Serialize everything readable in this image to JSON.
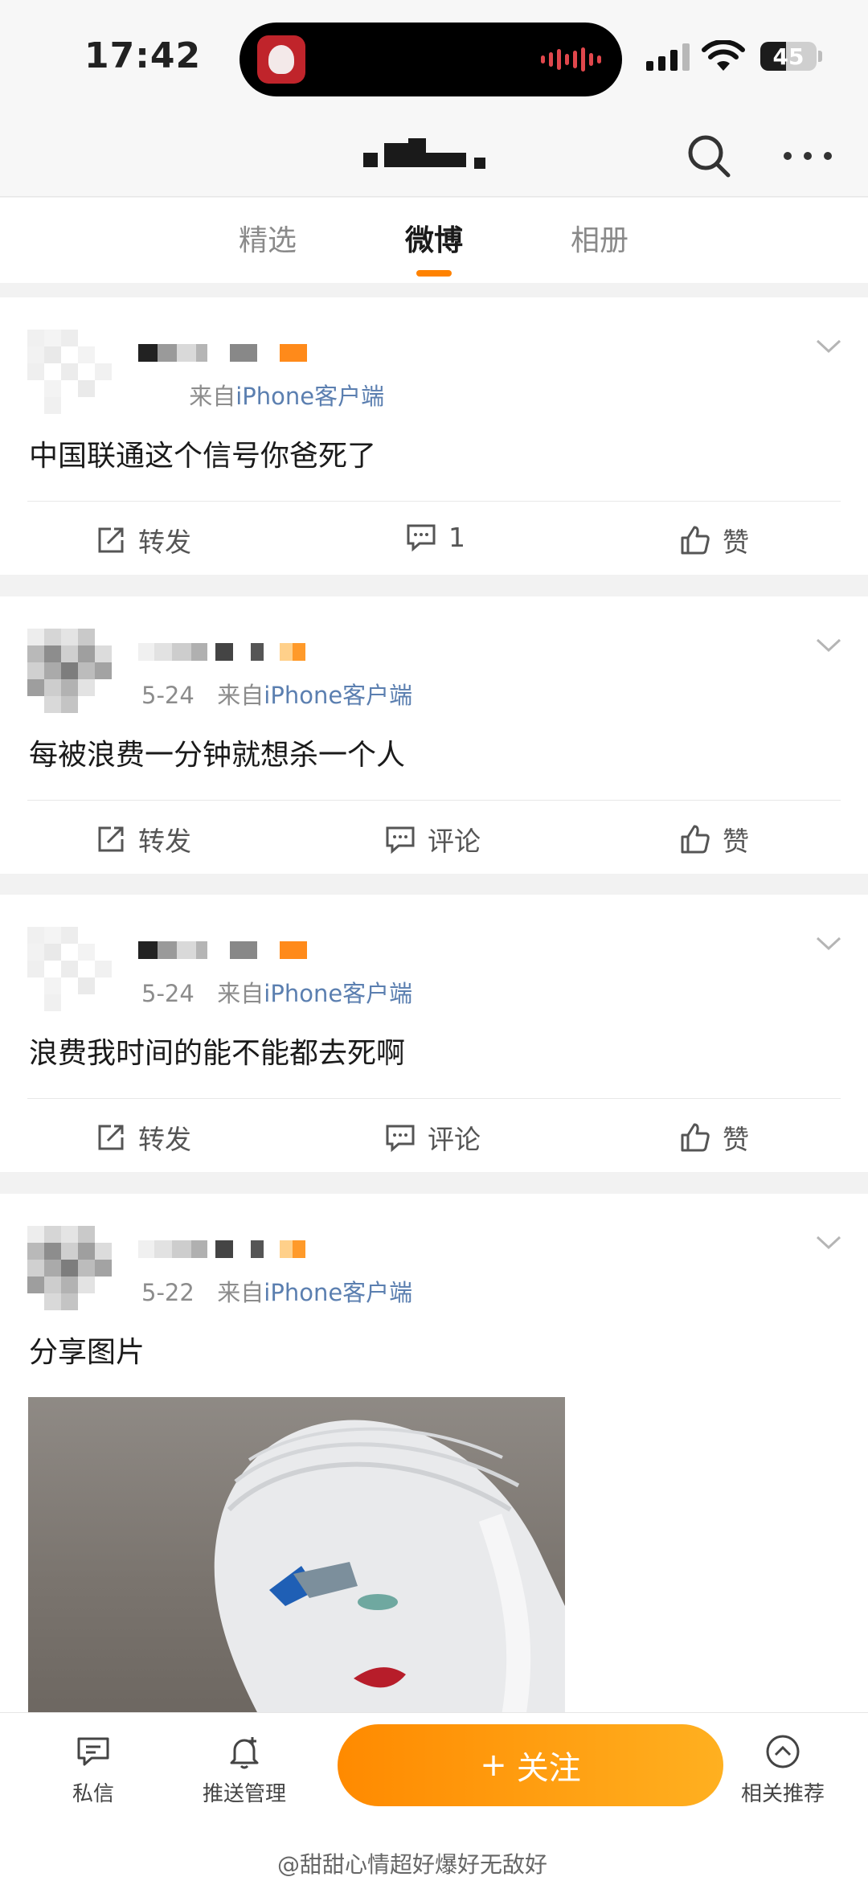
{
  "status_bar": {
    "time": "17:42",
    "battery": "45",
    "battery_level": 0.45
  },
  "nav": {
    "search_icon": "search-icon",
    "more_icon": "more-icon"
  },
  "tabs": [
    {
      "label": "精选",
      "active": false
    },
    {
      "label": "微博",
      "active": true
    },
    {
      "label": "相册",
      "active": false
    }
  ],
  "posts": [
    {
      "date": "",
      "source": "iPhone客户端",
      "meta_prefix": "来自",
      "text": "中国联通这个信号你爸死了",
      "repost": "转发",
      "comment": "1",
      "like": "赞"
    },
    {
      "date": "5-24",
      "source": "iPhone客户端",
      "meta_prefix": "来自",
      "text": "每被浪费一分钟就想杀一个人",
      "repost": "转发",
      "comment": "评论",
      "like": "赞"
    },
    {
      "date": "5-24",
      "source": "iPhone客户端",
      "meta_prefix": "来自",
      "text": "浪费我时间的能不能都去死啊",
      "repost": "转发",
      "comment": "评论",
      "like": "赞"
    },
    {
      "date": "5-22",
      "source": "iPhone客户端",
      "meta_prefix": "来自",
      "text": "分享图片",
      "repost": "",
      "comment": "",
      "like": ""
    }
  ],
  "bottom_bar": {
    "messages": "私信",
    "push": "推送管理",
    "follow": "关注",
    "follow_plus": "+",
    "related": "相关推荐"
  },
  "watermark": "@甜甜心情超好爆好无敌好",
  "colors": {
    "accent": "#ff8200",
    "link": "#5b7fb0"
  }
}
